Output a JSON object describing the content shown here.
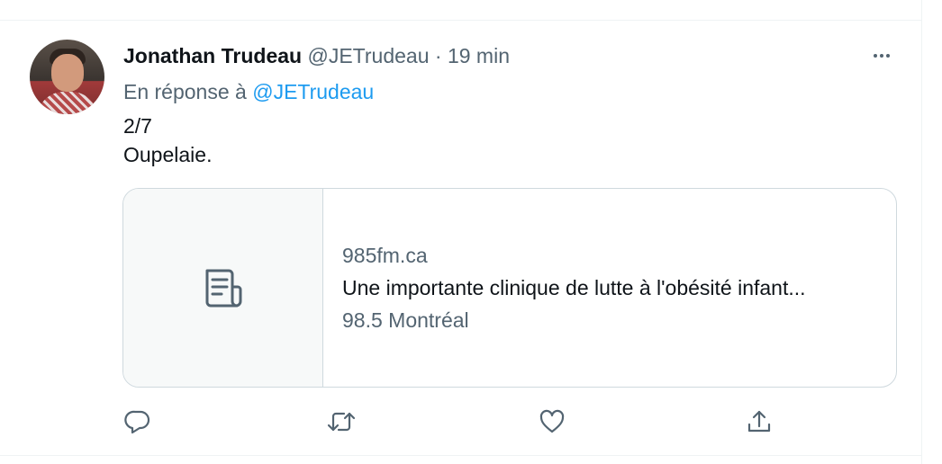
{
  "tweet": {
    "author_name": "Jonathan Trudeau",
    "handle": "@JETrudeau",
    "separator": "·",
    "time": "19 min",
    "reply_prefix": "En réponse à",
    "reply_to": "@JETrudeau",
    "text_line1": "2/7",
    "text_line2": "Oupelaie."
  },
  "card": {
    "domain": "985fm.ca",
    "title": "Une importante clinique de lutte à l'obésité infant...",
    "source": "98.5 Montréal",
    "media_icon": "article-icon"
  },
  "actions": [
    {
      "icon": "reply-icon"
    },
    {
      "icon": "retweet-icon"
    },
    {
      "icon": "like-icon"
    },
    {
      "icon": "share-icon"
    }
  ],
  "colors": {
    "text": "#0f1419",
    "secondary": "#536471",
    "link": "#1d9bf0",
    "border": "#cfd9de",
    "card_media_bg": "#f7f9f9"
  }
}
